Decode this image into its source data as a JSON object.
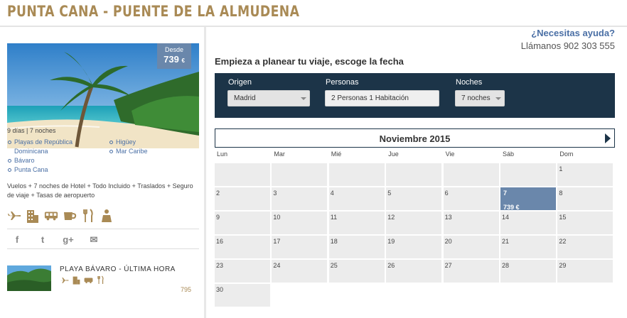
{
  "page": {
    "title": "PUNTA CANA - PUENTE DE LA ALMUDENA"
  },
  "offer": {
    "price_from_label": "Desde",
    "price": "739",
    "currency": "€",
    "duration": "9 días | 7 noches",
    "destinations_col1": [
      "Playas de República Dominicana",
      "Bávaro",
      "Punta Cana"
    ],
    "destinations_col2": [
      "Higüey",
      "Mar Caribe"
    ],
    "includes": "Vuelos + 7 noches de Hotel + Todo Incluido + Traslados + Seguro de viaje + Tasas de aeropuerto",
    "service_icons": [
      "airplane-icon",
      "hotel-icon",
      "bus-icon",
      "cup-icon",
      "restaurant-icon",
      "guide-icon"
    ]
  },
  "social": {
    "facebook": "f",
    "twitter": "t",
    "googleplus": "g+",
    "email": "✉"
  },
  "related": {
    "title": "PLAYA BÁVARO - ÚLTIMA HORA",
    "price": "795"
  },
  "help": {
    "question": "¿Necesitas ayuda?",
    "phone": "Llámanos 902 303 555"
  },
  "planner": {
    "title": "Empieza a planear tu viaje, escoge la fecha",
    "origin_label": "Origen",
    "origin_value": "Madrid",
    "people_label": "Personas",
    "people_value": "2 Personas 1 Habitación",
    "nights_label": "Noches",
    "nights_value": "7 noches"
  },
  "calendar": {
    "month": "Noviembre 2015",
    "weekdays": [
      "Lun",
      "Mar",
      "Mié",
      "Jue",
      "Vie",
      "Sáb",
      "Dom"
    ],
    "leading_empty": 6,
    "days": 30,
    "selected_day": 7,
    "selected_price": "739 €"
  },
  "colors": {
    "title_gold": "#a98a55",
    "navy": "#1c3448",
    "accent_blue": "#6a87ab",
    "link_blue": "#4a6fa5"
  }
}
